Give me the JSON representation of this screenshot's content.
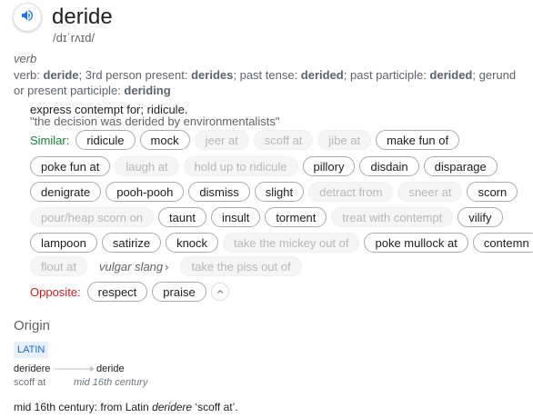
{
  "header": {
    "word": "deride",
    "phonetic": "/dɪˈrʌɪd/",
    "speaker_icon": "volume-icon"
  },
  "definition": {
    "part_of_speech": "verb",
    "forms": {
      "prefix": "verb: ",
      "base": "deride",
      "l1": "; 3rd person present: ",
      "third_person": "derides",
      "l2": "; past tense: ",
      "past_tense": "derided",
      "l3": "; past participle: ",
      "past_participle": "derided",
      "l4": "; gerund or present participle: ",
      "gerund": "deriding"
    },
    "meaning": "express contempt for; ridicule.",
    "example": "\"the decision was derided by environmentalists\""
  },
  "similar": {
    "label": "Similar:",
    "rows": [
      [
        {
          "t": "ridicule",
          "a": true
        },
        {
          "t": "mock",
          "a": true
        },
        {
          "t": "jeer at",
          "a": false
        },
        {
          "t": "scoff at",
          "a": false
        },
        {
          "t": "jibe at",
          "a": false
        },
        {
          "t": "make fun of",
          "a": true
        }
      ],
      [
        {
          "t": "poke fun at",
          "a": true
        },
        {
          "t": "laugh at",
          "a": false
        },
        {
          "t": "hold up to ridicule",
          "a": false
        },
        {
          "t": "pillory",
          "a": true
        },
        {
          "t": "disdain",
          "a": true
        },
        {
          "t": "disparage",
          "a": true
        }
      ],
      [
        {
          "t": "denigrate",
          "a": true
        },
        {
          "t": "pooh-pooh",
          "a": true
        },
        {
          "t": "dismiss",
          "a": true
        },
        {
          "t": "slight",
          "a": true
        },
        {
          "t": "detract from",
          "a": false
        },
        {
          "t": "sneer at",
          "a": false
        },
        {
          "t": "scorn",
          "a": true
        }
      ],
      [
        {
          "t": "pour/heap scorn on",
          "a": false
        },
        {
          "t": "taunt",
          "a": true
        },
        {
          "t": "insult",
          "a": true
        },
        {
          "t": "torment",
          "a": true
        },
        {
          "t": "treat with contempt",
          "a": false
        },
        {
          "t": "vilify",
          "a": true
        }
      ],
      [
        {
          "t": "lampoon",
          "a": true
        },
        {
          "t": "satirize",
          "a": true
        },
        {
          "t": "knock",
          "a": true
        },
        {
          "t": "take the mickey out of",
          "a": false
        },
        {
          "t": "poke mullock at",
          "a": true
        },
        {
          "t": "contemn",
          "a": true
        }
      ],
      [
        {
          "t": "flout at",
          "a": false
        },
        {
          "t": "vulgar slang",
          "a": "plain"
        },
        {
          "t": "take the piss out of",
          "a": false
        }
      ]
    ]
  },
  "opposite": {
    "label": "Opposite:",
    "items": [
      "respect",
      "praise"
    ]
  },
  "origin": {
    "title": "Origin",
    "language": "LATIN",
    "from_word": "deridere",
    "from_gloss": "scoff at",
    "to_word": "deride",
    "to_gloss": "mid 16th century",
    "text_before": "mid 16th century: from Latin ",
    "text_word": "deridere",
    "text_after": " ‘scoff at’."
  },
  "colors": {
    "similar_label": "#188038",
    "opposite_label": "#c5221f",
    "accent": "#1a73e8"
  }
}
